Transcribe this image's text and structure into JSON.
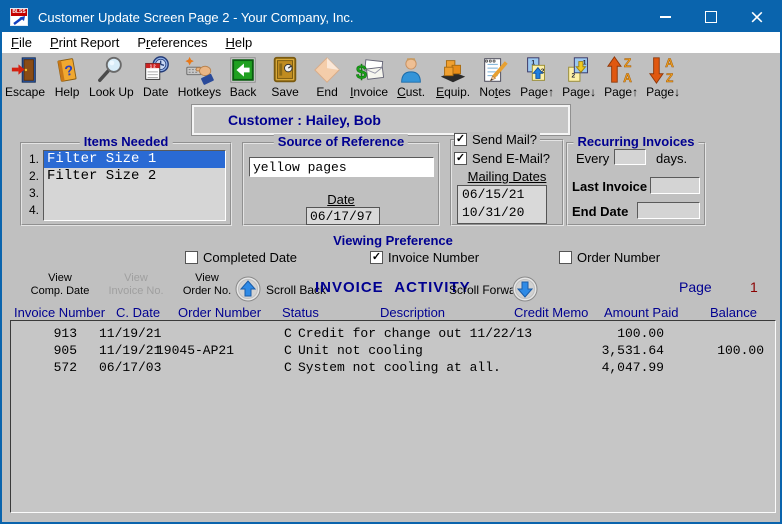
{
  "icons": {
    "check": "✓"
  },
  "colors": {
    "titlebar": "#0a64ad",
    "background": "#c0c0c0",
    "navy": "#000090",
    "page_number_red": "#8b0000",
    "selection_blue": "#2a6ad4"
  },
  "window": {
    "title": "Customer Update Screen Page 2 - Your Company, Inc.",
    "icon_label": "BLSS"
  },
  "menu": {
    "items": [
      {
        "label": "File",
        "accel": 0
      },
      {
        "label": "Print Report",
        "accel": 0
      },
      {
        "label": "Preferences",
        "accel": 1
      },
      {
        "label": "Help",
        "accel": 0
      }
    ]
  },
  "toolbar": {
    "buttons": [
      {
        "label": "Escape"
      },
      {
        "label": "Help"
      },
      {
        "label": "Look Up"
      },
      {
        "label": "Date"
      },
      {
        "label": "Hotkeys"
      },
      {
        "label": "Back"
      },
      {
        "label": "Save"
      },
      {
        "label": "End"
      },
      {
        "label": "Invoice",
        "accel": 0
      },
      {
        "label": "Cust.",
        "accel": 0
      },
      {
        "label": "Equip.",
        "accel": 0
      },
      {
        "label": "Notes",
        "accel": 2
      },
      {
        "label": "Page↑"
      },
      {
        "label": "Page↓"
      },
      {
        "label": "Page↑"
      },
      {
        "label": "Page↓"
      }
    ]
  },
  "customer_banner": {
    "label": "Customer : Hailey, Bob"
  },
  "items_needed": {
    "title": "Items Needed",
    "rows": [
      {
        "num": "1.",
        "text": "Filter Size 1",
        "selected": true
      },
      {
        "num": "2.",
        "text": "Filter Size 2",
        "selected": false
      },
      {
        "num": "3.",
        "text": "",
        "selected": false
      },
      {
        "num": "4.",
        "text": "",
        "selected": false
      }
    ]
  },
  "source_of_reference": {
    "title": "Source of Reference",
    "value": "yellow pages",
    "date_label": "Date",
    "date_value": "06/17/97"
  },
  "mailing": {
    "send_mail_label": "Send Mail?",
    "send_mail_checked": true,
    "send_email_label": "Send E-Mail?",
    "send_email_checked": true,
    "dates_label": "Mailing Dates",
    "dates": [
      "06/15/21",
      "10/31/20"
    ]
  },
  "recurring_invoices": {
    "title": "Recurring Invoices",
    "every_label": "Every",
    "every_value": "",
    "days_label": "days.",
    "last_invoice_label": "Last Invoice",
    "last_invoice_value": "",
    "end_date_label": "End Date",
    "end_date_value": ""
  },
  "viewing_preference": {
    "title": "Viewing Preference",
    "options": [
      {
        "label": "Completed Date",
        "checked": false
      },
      {
        "label": "Invoice Number",
        "checked": true
      },
      {
        "label": "Order Number",
        "checked": false
      }
    ]
  },
  "activity_bar": {
    "view_buttons": [
      {
        "line1": "View",
        "line2": "Comp. Date",
        "disabled": false
      },
      {
        "line1": "View",
        "line2": "Invoice No.",
        "disabled": true
      },
      {
        "line1": "View",
        "line2": "Order No.",
        "disabled": false
      }
    ],
    "scroll_back_label": "Scroll Back",
    "title": "INVOICE  ACTIVITY",
    "scroll_forward_label": "Scroll Forward",
    "page_label": "Page",
    "page_number": "1"
  },
  "invoice_table": {
    "headers": [
      "Invoice Number",
      "C. Date",
      "Order Number",
      "Status",
      "Description",
      "Credit Memo",
      "Amount Paid",
      "Balance"
    ],
    "rows": [
      {
        "invoice_number": "913",
        "c_date": "11/19/21",
        "order_number": "",
        "status": "C",
        "description": "Credit for change out 11/22/13",
        "credit_memo": "",
        "amount_paid": "100.00",
        "balance": ""
      },
      {
        "invoice_number": "905",
        "c_date": "11/19/21",
        "order_number": "19045-AP21",
        "status": "C",
        "description": "Unit not cooling",
        "credit_memo": "",
        "amount_paid": "3,531.64",
        "balance": "100.00"
      },
      {
        "invoice_number": "572",
        "c_date": "06/17/03",
        "order_number": "",
        "status": "C",
        "description": "System not cooling at all.",
        "credit_memo": "",
        "amount_paid": "4,047.99",
        "balance": ""
      }
    ]
  }
}
